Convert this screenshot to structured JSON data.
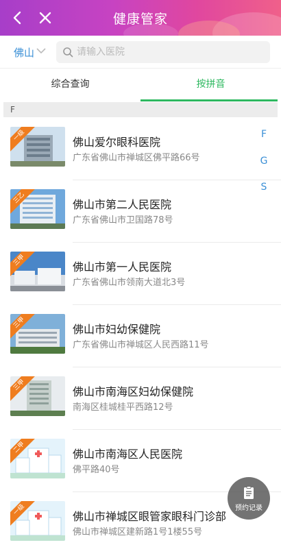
{
  "header": {
    "title": "健康管家",
    "colors": {
      "gradient_start": "#a73ec9",
      "gradient_end": "#f0608a"
    },
    "back_icon": "chevron-left-icon",
    "close_icon": "close-icon"
  },
  "search": {
    "city": "佛山",
    "placeholder": "请输入医院",
    "value": ""
  },
  "tabs": [
    {
      "label": "综合查询",
      "active": false
    },
    {
      "label": "按拼音",
      "active": true
    }
  ],
  "accent_color": "#2db85f",
  "group_letter": "F",
  "index_letters": [
    "F",
    "G",
    "S"
  ],
  "hospitals": [
    {
      "name": "佛山爱尔眼科医院",
      "address": "广东省佛山市禅城区佛平路66号",
      "grade": "一级"
    },
    {
      "name": "佛山市第二人民医院",
      "address": "广东省佛山市卫国路78号",
      "grade": "三乙"
    },
    {
      "name": "佛山市第一人民医院",
      "address": "广东省佛山市领南大道北3号",
      "grade": "三甲"
    },
    {
      "name": "佛山市妇幼保健院",
      "address": "广东省佛山市禅城区人民西路11号",
      "grade": "三甲"
    },
    {
      "name": "佛山市南海区妇幼保健院",
      "address": "南海区桂城桂平西路12号",
      "grade": "三甲"
    },
    {
      "name": "佛山市南海区人民医院",
      "address": "佛平路40号",
      "grade": "二甲"
    },
    {
      "name": "佛山市禅城区眼管家眼科门诊部",
      "address": "佛山市禅城区建新路1号1楼55号",
      "grade": "一级"
    }
  ],
  "fab": {
    "label": "预约记录",
    "icon": "clipboard-icon"
  }
}
